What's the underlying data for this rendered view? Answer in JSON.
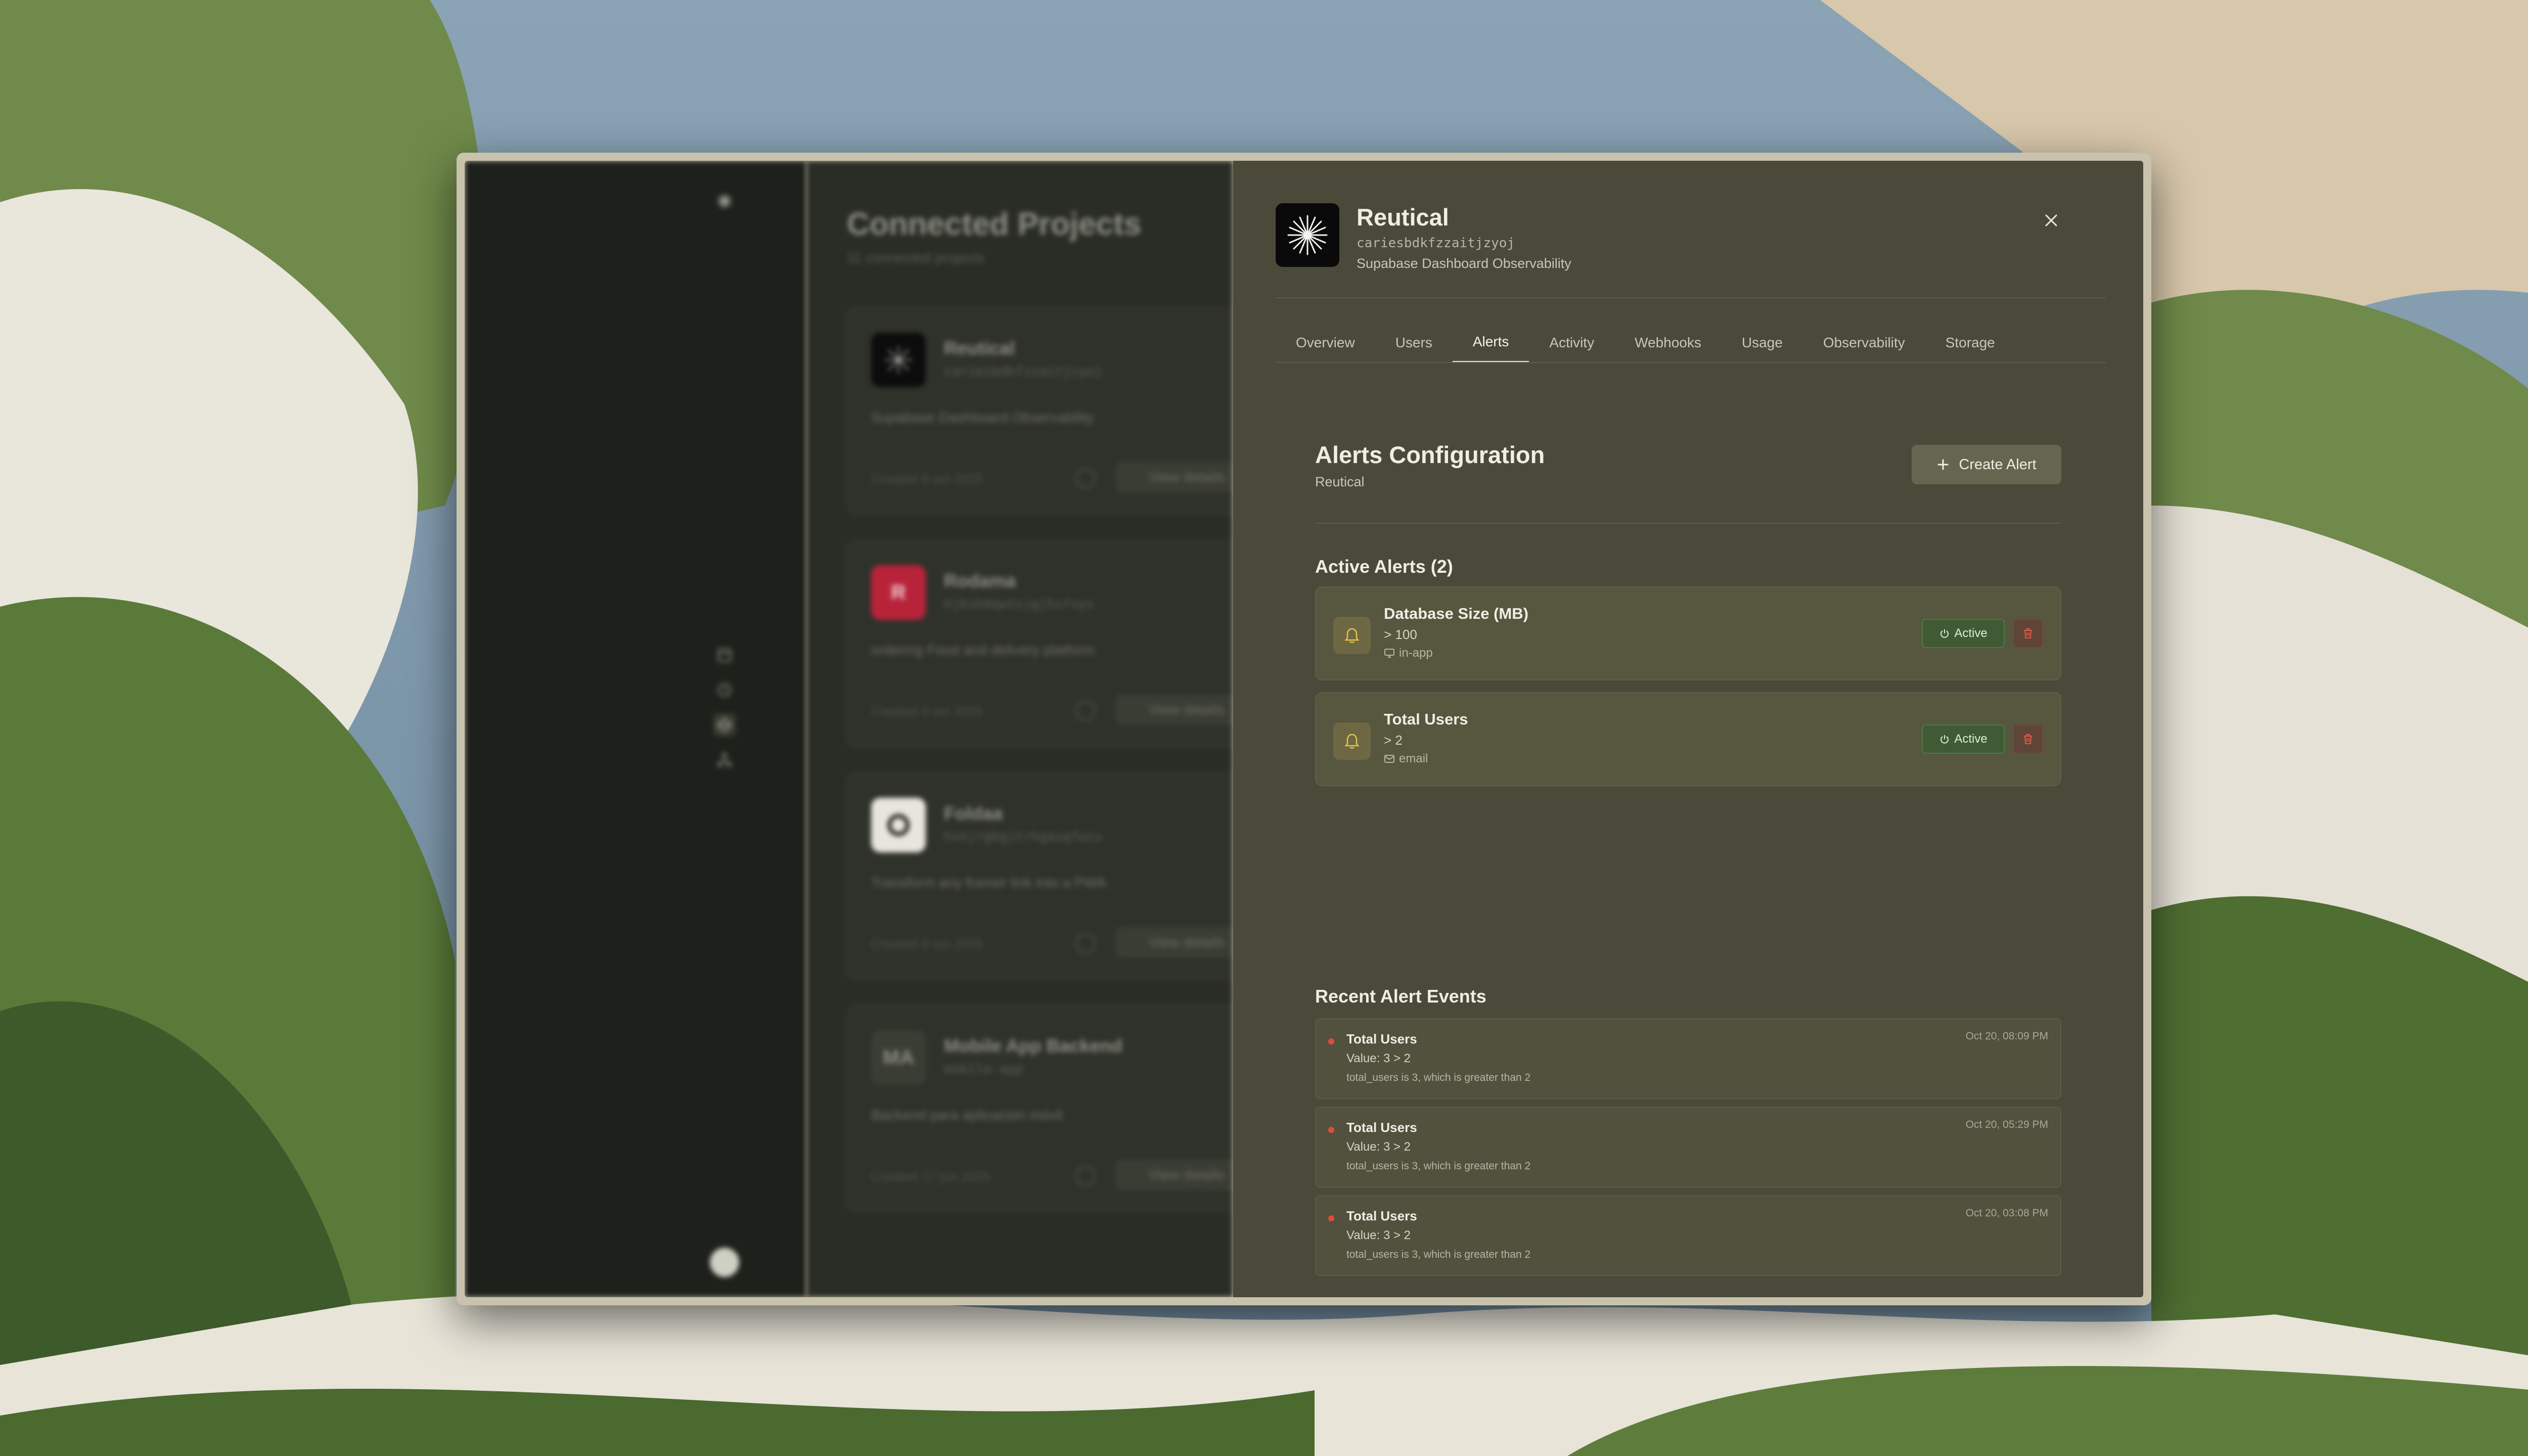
{
  "background_projects": {
    "title": "Connected Projects",
    "count_text": "11 connected projects",
    "projects": [
      {
        "name": "Reutical",
        "slug": "cariesbdkfzzaitjzyoj",
        "description": "Supabase Dashboard Observability",
        "created": "Created 6 oct 2025",
        "view_label": "View details",
        "logo_text": ""
      },
      {
        "name": "Rodama",
        "slug": "hjkshdqwtsjgjhsfsys",
        "description": "ordering Food and delivery platform",
        "created": "Created 6 oct 2025",
        "view_label": "View details",
        "logo_text": "R"
      },
      {
        "name": "Foldaa",
        "slug": "hsnjrgbgjtrhgasqfwiu",
        "description": "Transform any framer link into a PWA",
        "created": "Created 6 oct 2025",
        "view_label": "View details",
        "logo_text": ""
      },
      {
        "name": "Mobile App Backend",
        "slug": "mobile-app",
        "description": "Backend para aplicación móvil",
        "created": "Created 17 jun 2025",
        "view_label": "View details",
        "logo_text": "MA"
      }
    ]
  },
  "detail": {
    "name": "Reutical",
    "slug": "cariesbdkfzzaitjzyoj",
    "description": "Supabase Dashboard Observability",
    "tabs": [
      "Overview",
      "Users",
      "Alerts",
      "Activity",
      "Webhooks",
      "Usage",
      "Observability",
      "Storage"
    ],
    "active_tab": "Alerts",
    "alerts_config": {
      "title": "Alerts Configuration",
      "subtitle": "Reutical",
      "create_label": "Create Alert"
    },
    "active_alerts": {
      "title": "Active Alerts (2)",
      "items": [
        {
          "name": "Database Size (MB)",
          "condition": "> 100",
          "channel": "in-app",
          "channel_icon": "monitor-icon",
          "status": "Active"
        },
        {
          "name": "Total Users",
          "condition": "> 2",
          "channel": "email",
          "channel_icon": "mail-icon",
          "status": "Active"
        }
      ]
    },
    "recent_events": {
      "title": "Recent Alert Events",
      "items": [
        {
          "name": "Total Users",
          "value": "Value: 3 > 2",
          "message": "total_users is 3, which is greater than 2",
          "time": "Oct 20, 08:09 PM"
        },
        {
          "name": "Total Users",
          "value": "Value: 3 > 2",
          "message": "total_users is 3, which is greater than 2",
          "time": "Oct 20, 05:29 PM"
        },
        {
          "name": "Total Users",
          "value": "Value: 3 > 2",
          "message": "total_users is 3, which is greater than 2",
          "time": "Oct 20, 03:08 PM"
        }
      ]
    }
  },
  "colors": {
    "panel_bg": "#4b4a3a",
    "active_green": "#3f5a35",
    "delete_red": "#e05a4a",
    "bell_yellow": "#e6c34a",
    "event_dot": "#e04a3c"
  }
}
